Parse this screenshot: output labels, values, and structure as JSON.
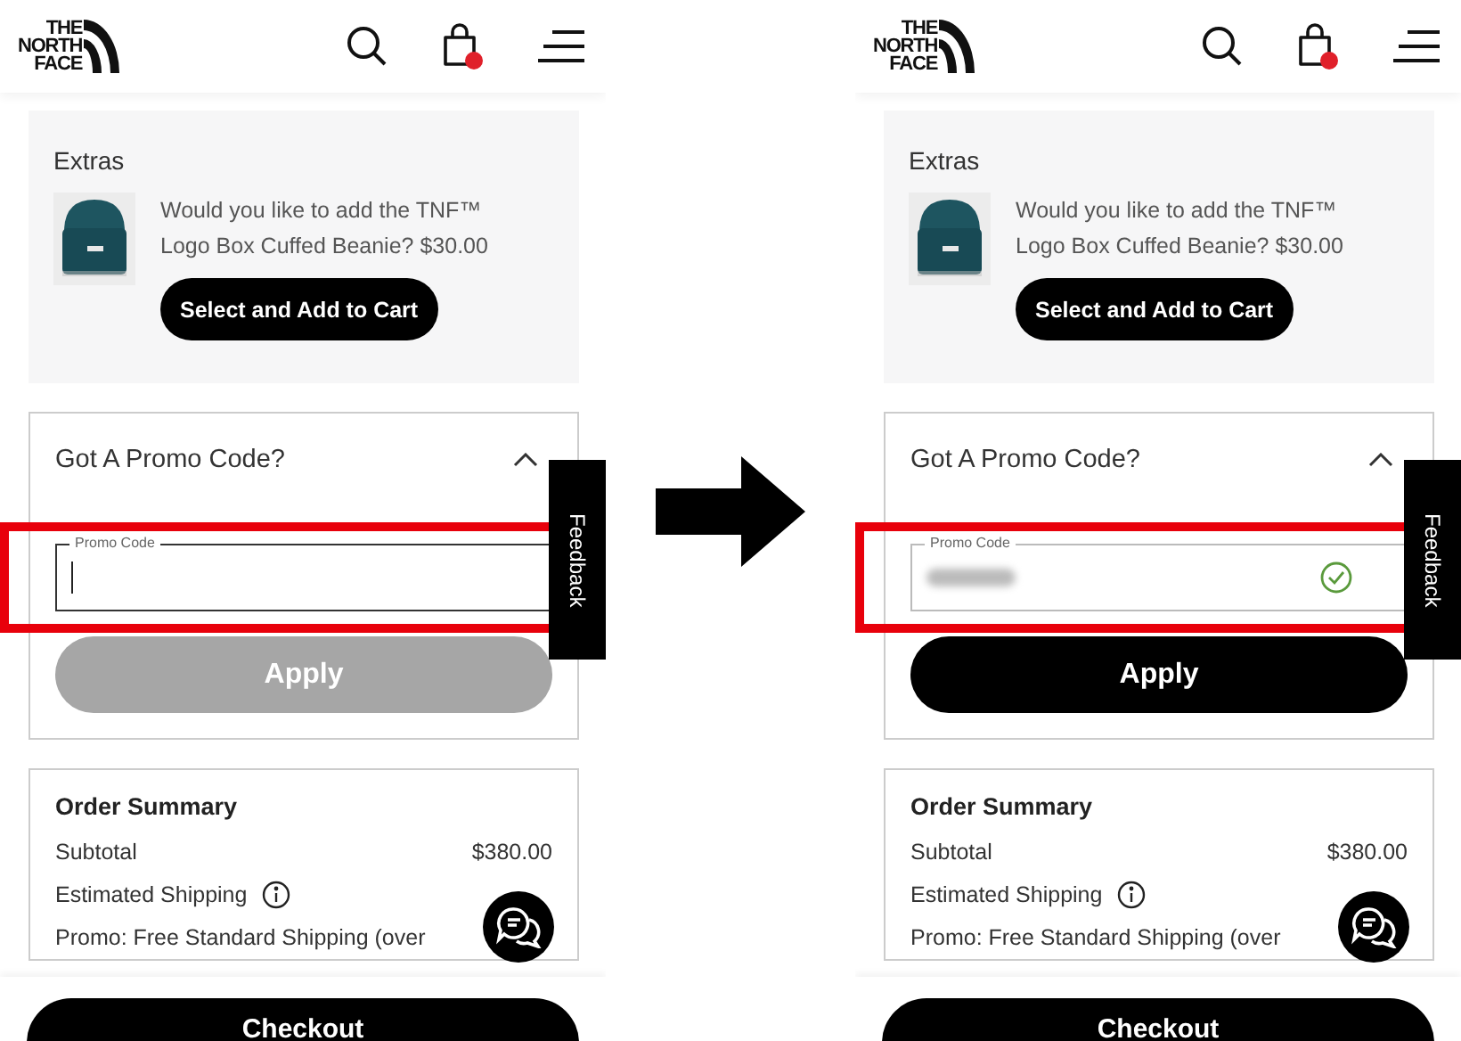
{
  "screens": [
    {
      "logo": [
        "THE",
        "NORTH",
        "FACE"
      ],
      "extras": {
        "title": "Extras",
        "offer": "Would you like to add the TNF™ Logo Box Cuffed Beanie? $30.00",
        "button": "Select and Add to Cart"
      },
      "promo": {
        "title": "Got A Promo Code?",
        "expanded": true,
        "field_label": "Promo Code",
        "focused": true,
        "value_blurred": false,
        "valid": false,
        "apply": {
          "label": "Apply",
          "disabled": true
        }
      },
      "highlighted": true,
      "feedback": "Feedback",
      "summary": {
        "title": "Order Summary",
        "rows": [
          {
            "label": "Subtotal",
            "value": "$380.00"
          },
          {
            "label": "Estimated Shipping",
            "info": true
          },
          {
            "label": "Promo: Free Standard Shipping (over"
          }
        ]
      },
      "checkout": "Checkout"
    },
    {
      "logo": [
        "THE",
        "NORTH",
        "FACE"
      ],
      "extras": {
        "title": "Extras",
        "offer": "Would you like to add the TNF™ Logo Box Cuffed Beanie? $30.00",
        "button": "Select and Add to Cart"
      },
      "promo": {
        "title": "Got A Promo Code?",
        "expanded": true,
        "field_label": "Promo Code",
        "focused": false,
        "value_blurred": true,
        "valid": true,
        "apply": {
          "label": "Apply",
          "disabled": false
        }
      },
      "highlighted": true,
      "feedback": "Feedback",
      "summary": {
        "title": "Order Summary",
        "rows": [
          {
            "label": "Subtotal",
            "value": "$380.00"
          },
          {
            "label": "Estimated Shipping",
            "info": true
          },
          {
            "label": "Promo: Free Standard Shipping (over"
          }
        ]
      },
      "checkout": "Checkout"
    }
  ]
}
